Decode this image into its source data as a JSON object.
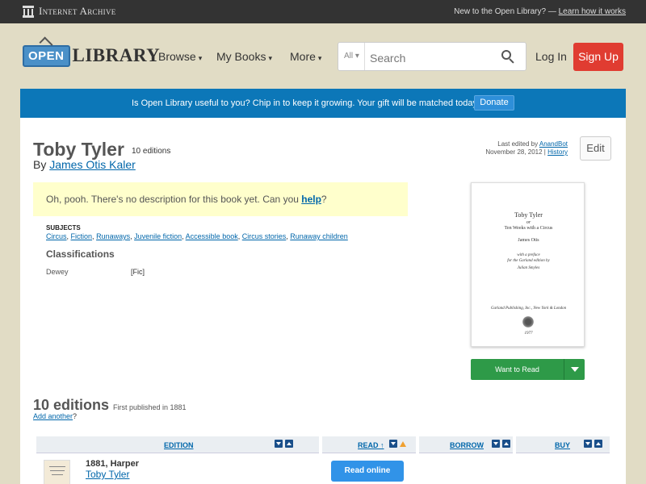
{
  "ia_bar": {
    "logo_text": "Internet Archive",
    "tagline": "New to the Open Library? — ",
    "learn_link": "Learn how it works"
  },
  "header": {
    "logo_open": "OPEN",
    "logo_library": "LIBRARY",
    "nav": {
      "browse": "Browse",
      "mybooks": "My Books",
      "more": "More"
    },
    "search": {
      "scope": "All",
      "placeholder": "Search"
    },
    "login": "Log In",
    "signup": "Sign Up"
  },
  "donate": {
    "text": "Is Open Library useful to you? Chip in to keep it growing. Your gift will be matched today!",
    "button": "Donate"
  },
  "book": {
    "title": "Toby Tyler",
    "edition_count": "10 editions",
    "by": "By ",
    "author": "James Otis Kaler",
    "last_edited_label": "Last edited by ",
    "last_edited_user": "AnandBot",
    "last_edited_date": "November 28, 2012 | ",
    "history": "History",
    "edit": "Edit",
    "no_description": "Oh, pooh. There's no description for this book yet. Can you ",
    "help": "help",
    "no_description_end": "?",
    "subjects_heading": "SUBJECTS",
    "subjects": [
      "Circus",
      "Fiction",
      "Runaways",
      "Juvenile fiction",
      "Accessible book",
      "Circus stories",
      "Runaway children"
    ],
    "classifications_heading": "Classifications",
    "dewey_label": "Dewey",
    "dewey_value": "[Fic]"
  },
  "cover": {
    "title": "Toby Tyler",
    "or": "or",
    "subtitle": "Ten Weeks with a Circus",
    "author": "James Otis",
    "preface1": "with a preface",
    "preface2": "for the Garland edition by",
    "preface3": "Julian Smyles",
    "publisher": "Garland Publishing, Inc., New York & London",
    "year": "1977"
  },
  "want_to_read": "Want to Read",
  "editions": {
    "heading": "10 editions",
    "first_published": "First published in 1881",
    "add_another": "Add another",
    "add_another_suffix": "?",
    "columns": {
      "edition": "EDITION",
      "read": "READ ↑",
      "borrow": "BORROW",
      "buy": "BUY"
    },
    "rows": [
      {
        "year_publisher": "1881, Harper",
        "title": "Toby Tyler",
        "action": "Read online"
      }
    ]
  },
  "colors": {
    "ia_bar": "#333333",
    "page_bg": "#e1dcc5",
    "donate_bar": "#0c77b8",
    "signup": "#e03c31",
    "want_to_read": "#2e9a48",
    "read_online": "#3193e8",
    "link": "#0066aa"
  }
}
